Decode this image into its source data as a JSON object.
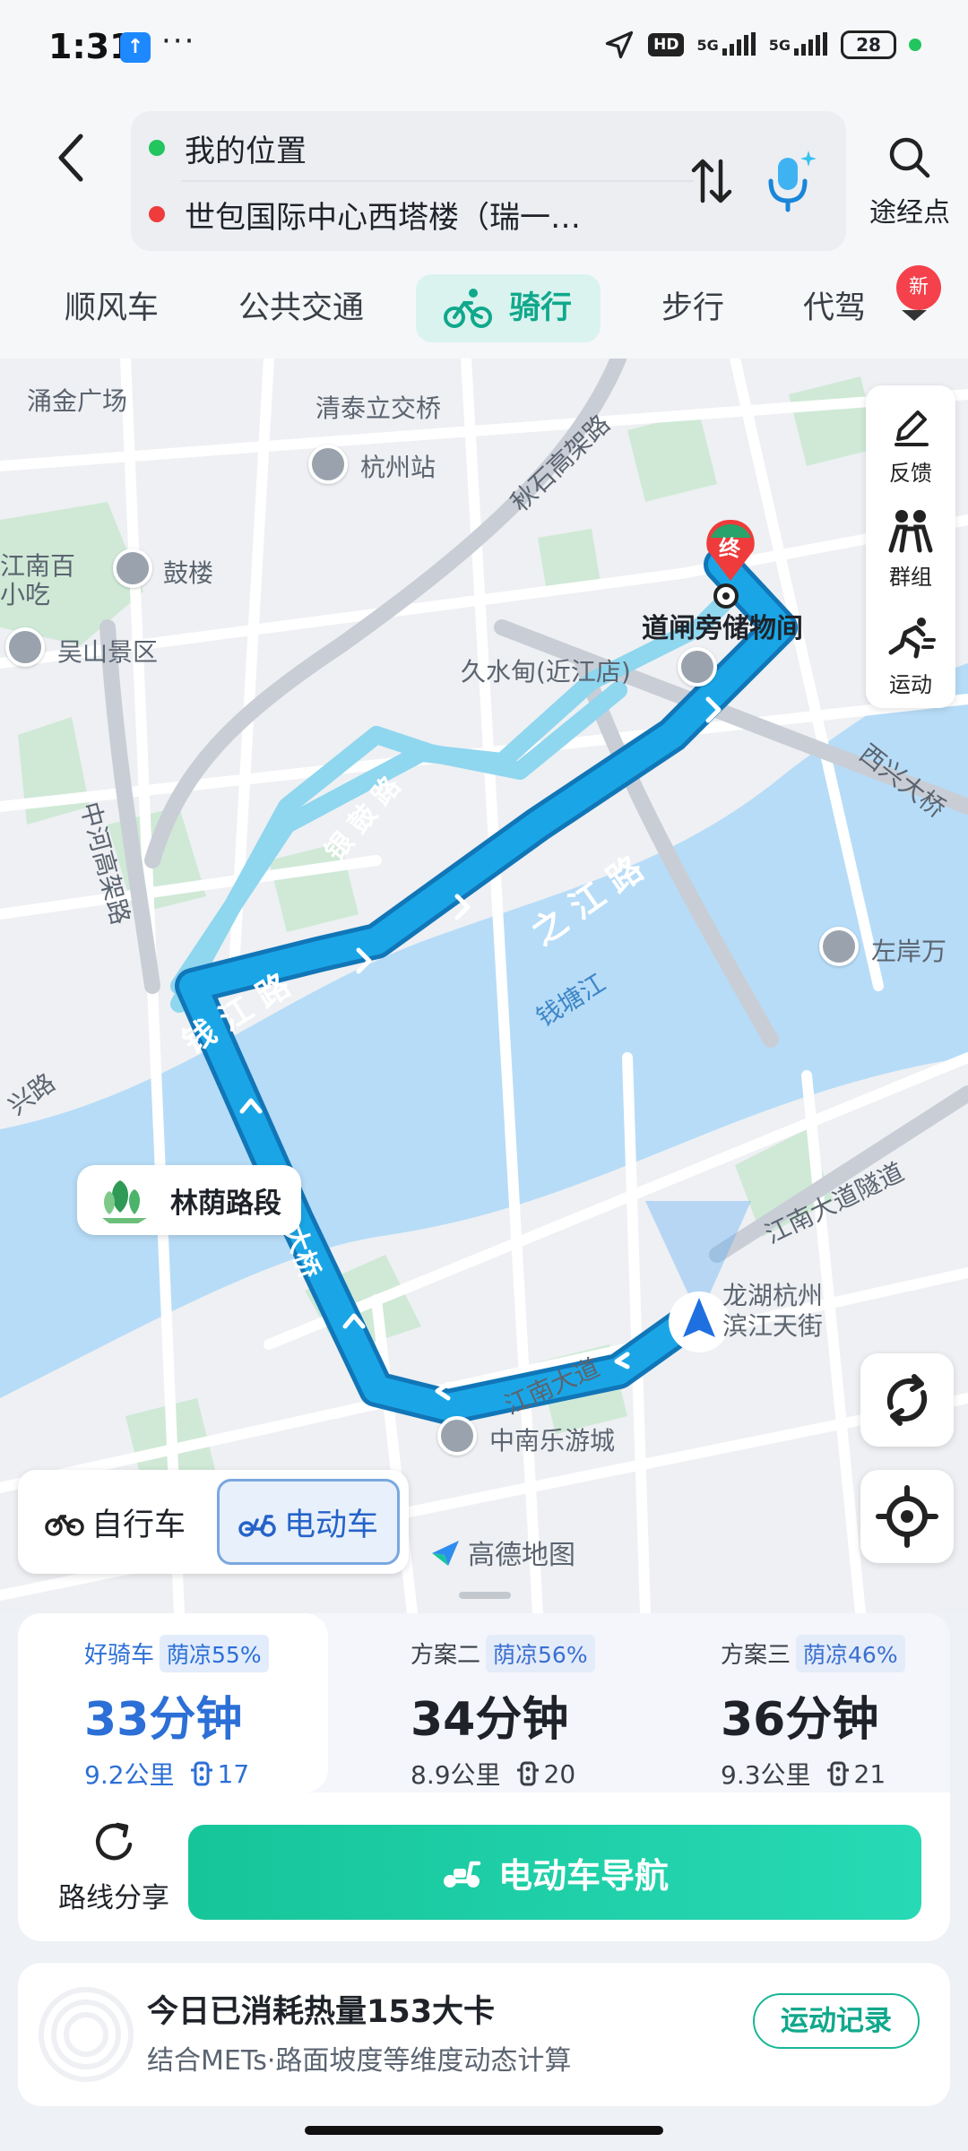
{
  "status_bar": {
    "time": "1:31",
    "hd_label": "HD",
    "signal1": "5G",
    "signal2": "5G",
    "battery": "28",
    "dots": "···"
  },
  "header": {
    "origin": "我的位置",
    "destination": "世包国际中心西塔楼（瑞一…",
    "waypoint_label": "途经点"
  },
  "tabs": [
    {
      "label": "顺风车"
    },
    {
      "label": "公共交通"
    },
    {
      "label": "骑行"
    },
    {
      "label": "步行"
    },
    {
      "label": "代驾"
    }
  ],
  "new_badge": "新",
  "map": {
    "labels": {
      "yongjin": "涌金广场",
      "qingtai": "清泰立交桥",
      "hangzhou_station": "杭州站",
      "jiangnan_snack": "江南百",
      "jiangnan_snack2": "小吃",
      "gulou": "鼓楼",
      "wushan": "吴山景区",
      "qiushi": "秋石高架路",
      "terminal_label": "道闸旁储物间",
      "jiushuidian": "久水甸(近江店)",
      "yingu": "银 鼓 路",
      "zhijiang": "之 江 路",
      "qianjiang": "钱 江 路",
      "zhonghe": "中河高架路",
      "qiantang": "钱塘江",
      "xixing": "西兴大桥",
      "zuoan": "左岸万",
      "jiangnan_tunnel": "江南大道隧道",
      "longhu": "龙湖杭州",
      "binjiang": "滨江天街",
      "jiangnan_road": "江南大道",
      "zhongnan": "中南乐游城",
      "xing_road": "兴路",
      "daqiao": "大桥",
      "end_marker": "终"
    },
    "forest_label": "林荫路段",
    "tools": [
      {
        "label": "反馈",
        "icon": "pen-icon"
      },
      {
        "label": "群组",
        "icon": "group-icon"
      },
      {
        "label": "运动",
        "icon": "running-icon"
      }
    ],
    "vehicle": {
      "bike": "自行车",
      "ebike": "电动车",
      "selected": "电动车"
    },
    "logo": "高德地图"
  },
  "plans": [
    {
      "title": "好骑车",
      "tag": "荫凉55%",
      "time": "33分钟",
      "distance": "9.2公里",
      "lights": "17",
      "selected": true
    },
    {
      "title": "方案二",
      "tag": "荫凉56%",
      "time": "34分钟",
      "distance": "8.9公里",
      "lights": "20",
      "selected": false
    },
    {
      "title": "方案三",
      "tag": "荫凉46%",
      "time": "36分钟",
      "distance": "9.3公里",
      "lights": "21",
      "selected": false
    }
  ],
  "actions": {
    "share_label": "路线分享",
    "nav_label": "电动车导航"
  },
  "calorie": {
    "title": "今日已消耗热量153大卡",
    "subtitle": "结合METs·路面坡度等维度动态计算",
    "record_button": "运动记录"
  },
  "colors": {
    "route_primary": "#1aa6e6",
    "route_alt": "#8fd6ef",
    "water": "#b7dcf7",
    "accent_green": "#17c59a",
    "accent_blue": "#2c6fd6"
  }
}
